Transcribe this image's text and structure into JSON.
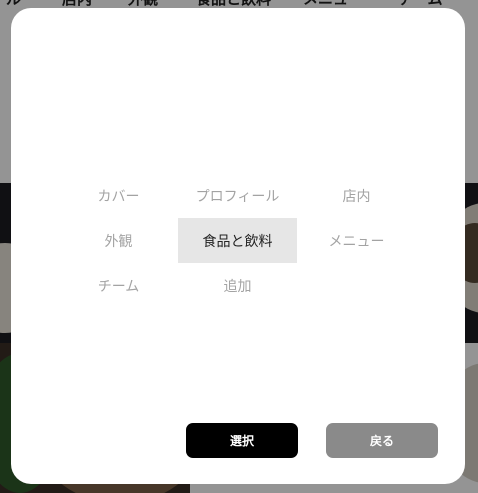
{
  "background": {
    "tabs": [
      "ル",
      "店内",
      "外観",
      "食品と飲料",
      "メニュー",
      "チーム"
    ]
  },
  "modal": {
    "categories": [
      {
        "label": "カバー",
        "selected": false
      },
      {
        "label": "プロフィール",
        "selected": false
      },
      {
        "label": "店内",
        "selected": false
      },
      {
        "label": "外観",
        "selected": false
      },
      {
        "label": "食品と飲料",
        "selected": true
      },
      {
        "label": "メニュー",
        "selected": false
      },
      {
        "label": "チーム",
        "selected": false
      },
      {
        "label": "追加",
        "selected": false
      }
    ],
    "select_label": "選択",
    "back_label": "戻る"
  },
  "colors": {
    "selected_bg": "#e6e6e6",
    "select_button": "#000000",
    "back_button": "#8a8a8a",
    "overlay": "rgba(0,0,0,0.42)"
  }
}
